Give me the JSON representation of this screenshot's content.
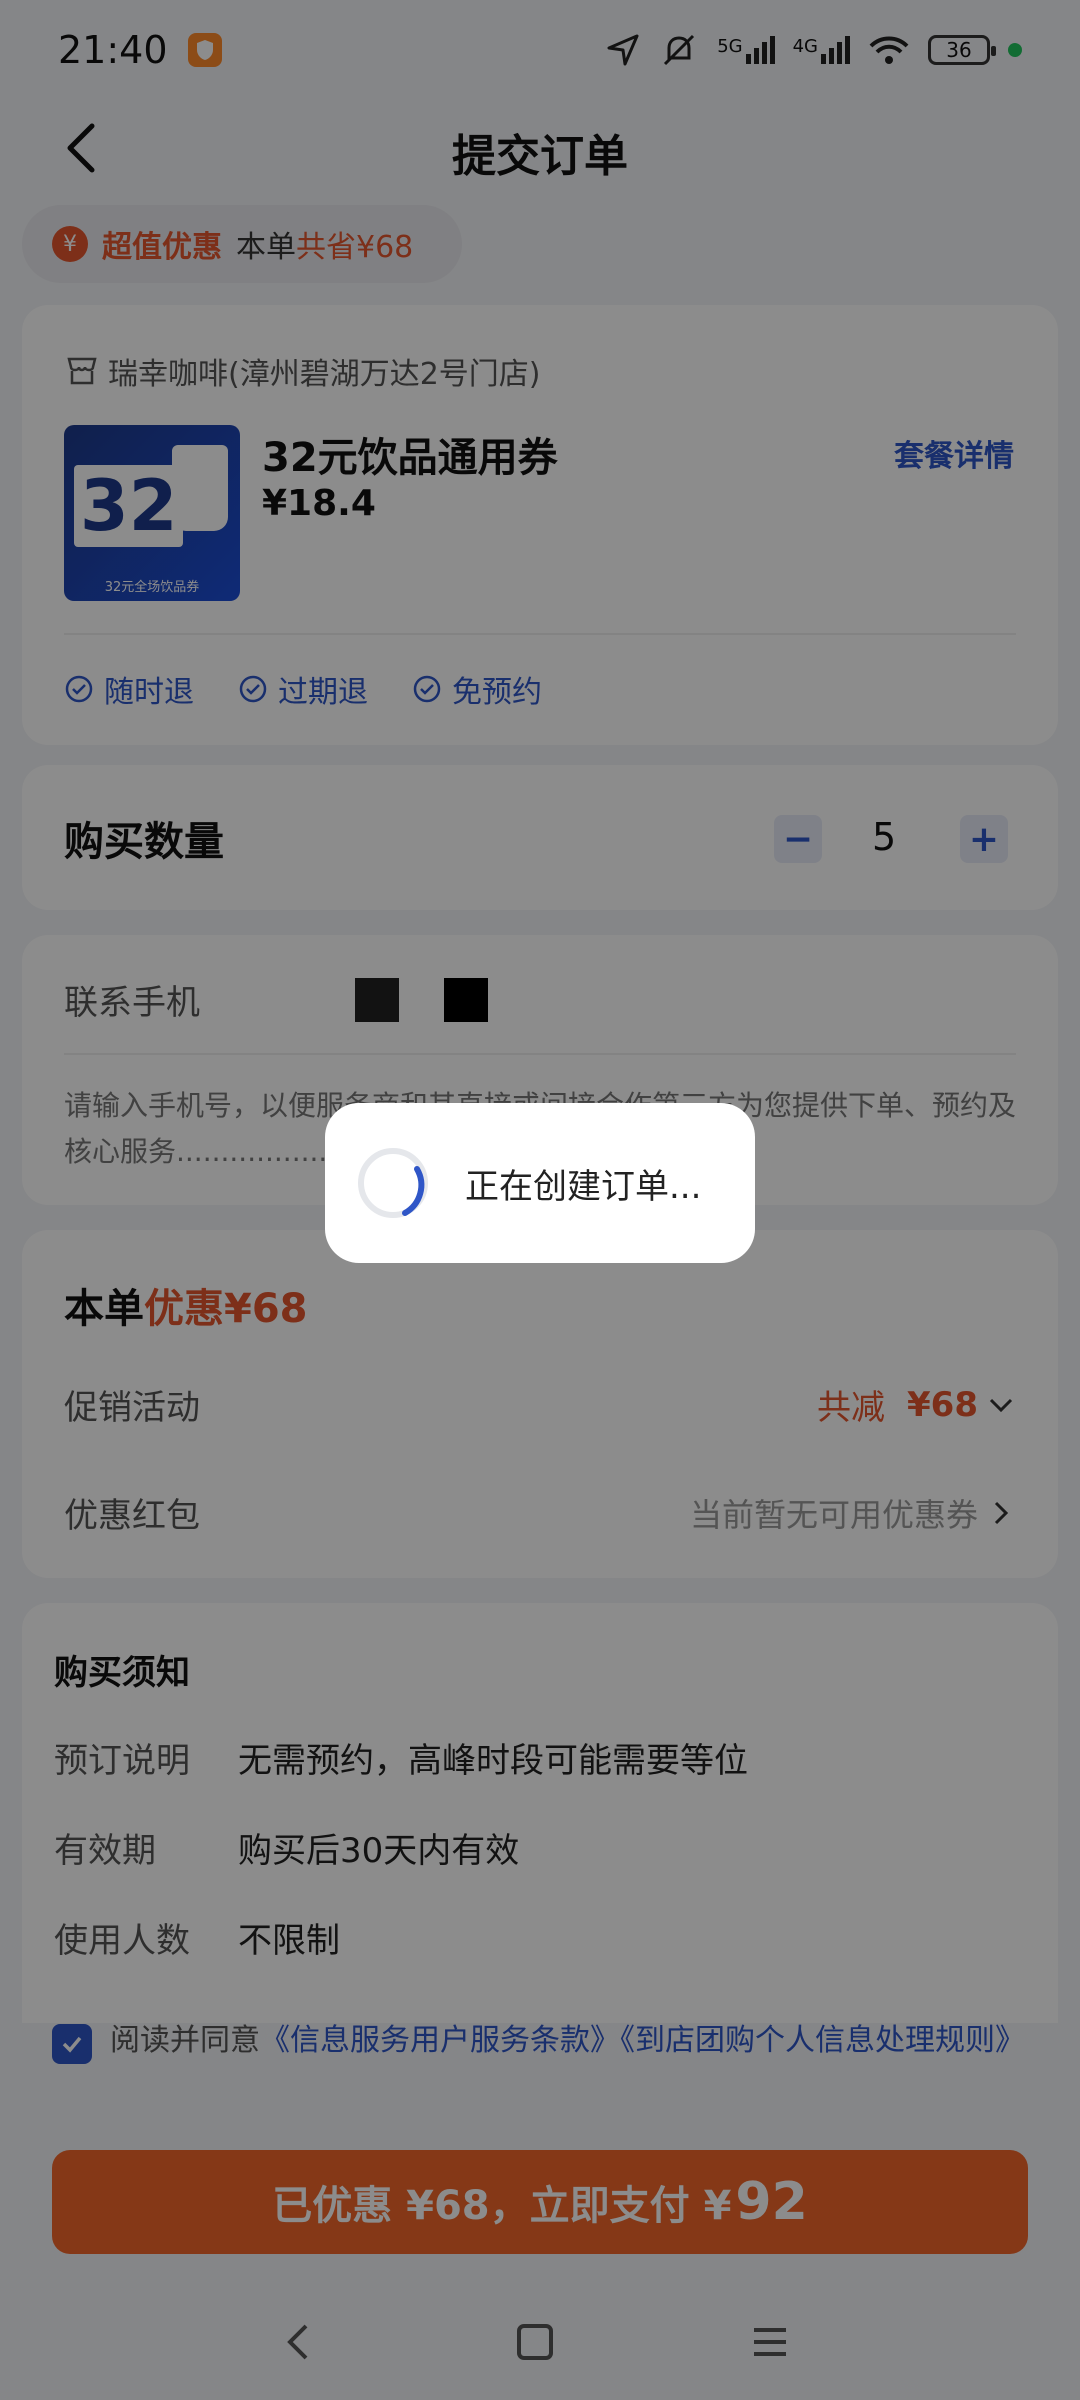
{
  "status_bar": {
    "time": "21:40",
    "battery": "36",
    "net1": "5G",
    "net2": "4G"
  },
  "nav": {
    "title": "提交订单"
  },
  "promo_pill": {
    "icon": "¥",
    "strong": "超值优惠",
    "text": "本单",
    "amount": "共省¥68"
  },
  "shop": {
    "name": "瑞幸咖啡(漳州碧湖万达2号门店)",
    "product_title": "32元饮品通用券",
    "price": "¥18.4",
    "package_link": "套餐详情",
    "image_big": "32",
    "image_caption": "32元全场饮品券",
    "tags": [
      "随时退",
      "过期退",
      "免预约"
    ]
  },
  "quantity": {
    "label": "购买数量",
    "minus": "−",
    "value": "5",
    "plus": "+"
  },
  "contact": {
    "label": "联系手机",
    "note": "请输入手机号，以便服务商和其直接或间接合作第三方为您提供下单、预约及核心服务..........................以核销码提示为准)"
  },
  "discount": {
    "title_prefix": "本单",
    "title_accent": "优惠¥68",
    "promo_label": "促销活动",
    "promo_value": "共减",
    "promo_amount": "¥68",
    "coupon_label": "优惠红包",
    "coupon_value": "当前暂无可用优惠券"
  },
  "notice": {
    "title": "购买须知",
    "rows": [
      {
        "k": "预订说明",
        "v": "无需预约，高峰时段可能需要等位"
      },
      {
        "k": "有效期",
        "v": "购买后30天内有效"
      },
      {
        "k": "使用人数",
        "v": "不限制"
      }
    ]
  },
  "agreement": {
    "prefix": "阅读并同意",
    "link1": "《信息服务用户服务条款》",
    "link2": "《到店团购个人信息处理规则》"
  },
  "pay": {
    "prefix": "已优惠 ¥68，立即支付 ¥",
    "amount": "92"
  },
  "loading": {
    "text": "正在创建订单..."
  },
  "colors": {
    "accent": "#e4572e",
    "link": "#2f56c7",
    "pay": "#f2672a"
  }
}
